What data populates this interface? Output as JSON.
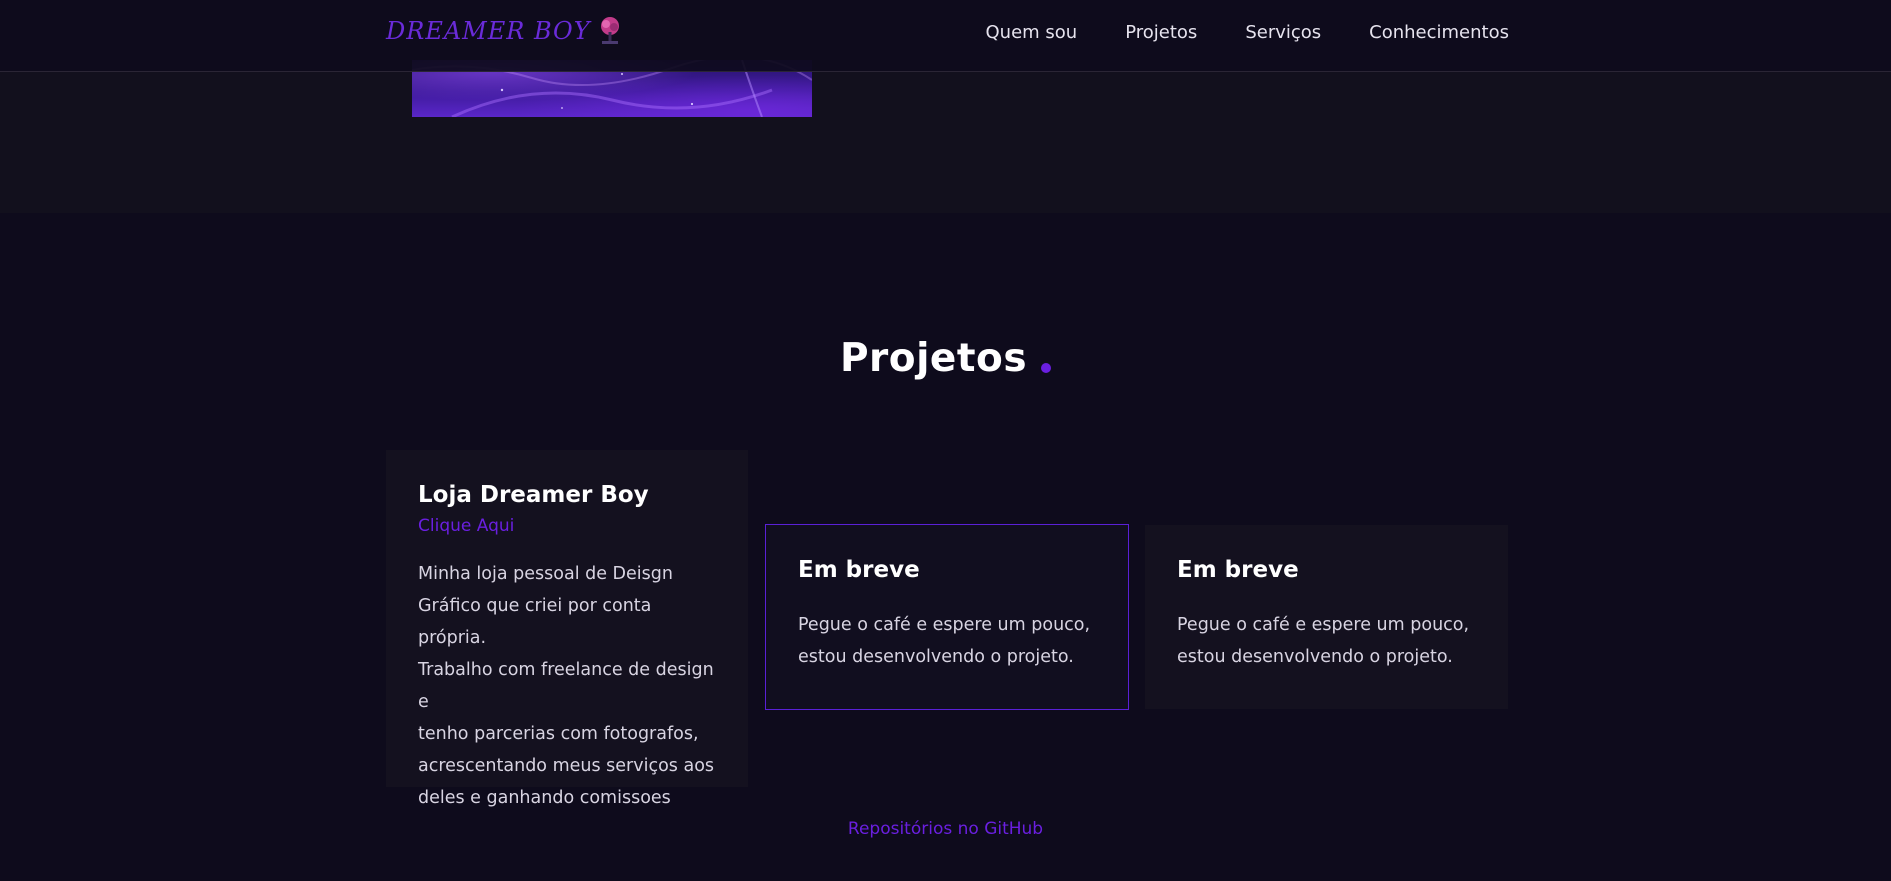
{
  "navbar": {
    "logo_text": "Dreamer Boy",
    "logo_icon": "tree-emblem-icon",
    "links": [
      {
        "label": "Quem sou"
      },
      {
        "label": "Projetos"
      },
      {
        "label": "Serviços"
      },
      {
        "label": "Conhecimentos"
      }
    ]
  },
  "projects": {
    "title": "Projetos",
    "accent_color": "#6a1fe0",
    "cards": [
      {
        "title": "Loja Dreamer Boy",
        "link_label": "Clique Aqui",
        "lines": [
          "Minha loja pessoal de Deisgn",
          "Gráfico que criei por conta própria.",
          "Trabalho com freelance de design e",
          "tenho parcerias com fotografos,",
          "acrescentando meus serviços aos",
          "deles e ganhando comissoes"
        ]
      },
      {
        "title": "Em breve",
        "lines": [
          "Pegue o café e espere um pouco,",
          "estou desenvolvendo o projeto."
        ]
      },
      {
        "title": "Em breve",
        "lines": [
          "Pegue o café e espere um pouco,",
          "estou desenvolvendo o projeto."
        ]
      }
    ],
    "github_label": "Repositórios no GitHub"
  }
}
